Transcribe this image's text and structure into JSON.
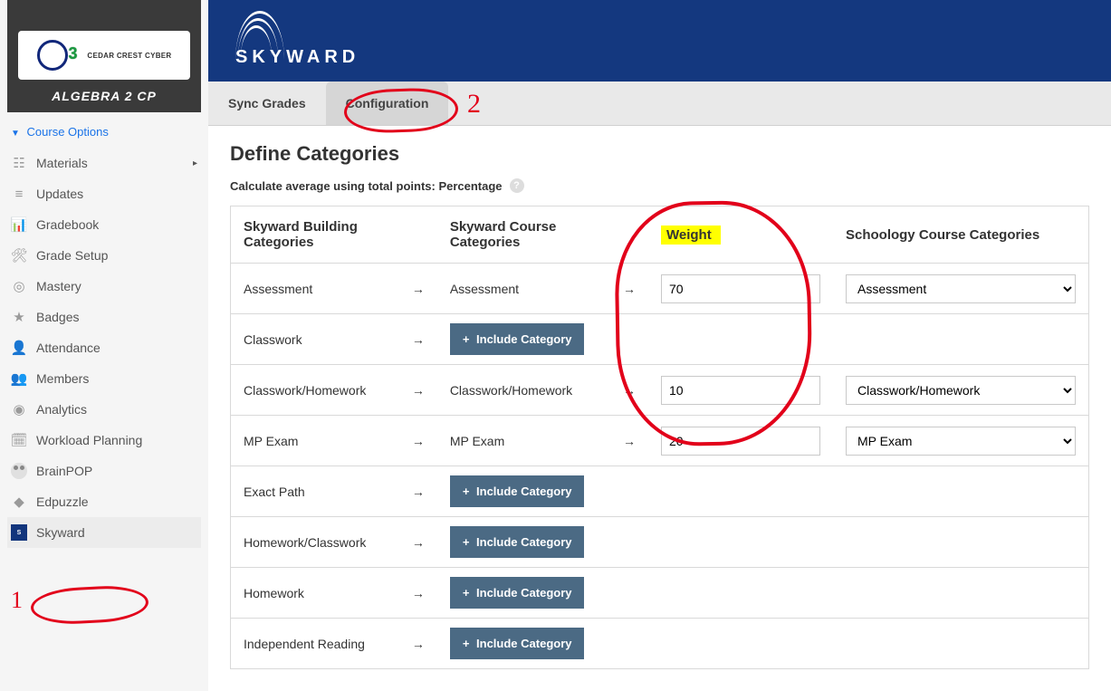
{
  "course": {
    "logo_small_text": "CEDAR CREST CYBER",
    "title": "ALGEBRA 2 CP"
  },
  "course_options_label": "Course Options",
  "nav": [
    {
      "label": "Materials",
      "icon": "☷",
      "has_children": true
    },
    {
      "label": "Updates",
      "icon": "≡"
    },
    {
      "label": "Gradebook",
      "icon": "📊"
    },
    {
      "label": "Grade Setup",
      "icon": "🛠"
    },
    {
      "label": "Mastery",
      "icon": "◎"
    },
    {
      "label": "Badges",
      "icon": "★"
    },
    {
      "label": "Attendance",
      "icon": "👤"
    },
    {
      "label": "Members",
      "icon": "👥"
    },
    {
      "label": "Analytics",
      "icon": "◉"
    },
    {
      "label": "Workload Planning",
      "icon": "🗓"
    },
    {
      "label": "BrainPOP",
      "icon": "bp"
    },
    {
      "label": "Edpuzzle",
      "icon": "◆"
    },
    {
      "label": "Skyward",
      "icon": "sky"
    }
  ],
  "brand_word": "SKYWARD",
  "tabs": {
    "sync": "Sync Grades",
    "config": "Configuration"
  },
  "page_title": "Define Categories",
  "calc_label": "Calculate average using total points: Percentage",
  "columns": {
    "building": "Skyward Building Categories",
    "course": "Skyward Course Categories",
    "weight": "Weight",
    "schoology": "Schoology Course Categories"
  },
  "include_label": "Include Category",
  "rows": [
    {
      "building": "Assessment",
      "course": "Assessment",
      "weight": "70",
      "schoology": "Assessment"
    },
    {
      "building": "Classwork",
      "course": null,
      "weight": "",
      "schoology": ""
    },
    {
      "building": "Classwork/Homework",
      "course": "Classwork/Homework",
      "weight": "10",
      "schoology": "Classwork/Homework"
    },
    {
      "building": "MP Exam",
      "course": "MP Exam",
      "weight": "20",
      "schoology": "MP Exam"
    },
    {
      "building": "Exact Path",
      "course": null,
      "weight": "",
      "schoology": ""
    },
    {
      "building": "Homework/Classwork",
      "course": null,
      "weight": "",
      "schoology": ""
    },
    {
      "building": "Homework",
      "course": null,
      "weight": "",
      "schoology": ""
    },
    {
      "building": "Independent Reading",
      "course": null,
      "weight": "",
      "schoology": ""
    }
  ],
  "annotations": {
    "one": "1",
    "two": "2"
  }
}
